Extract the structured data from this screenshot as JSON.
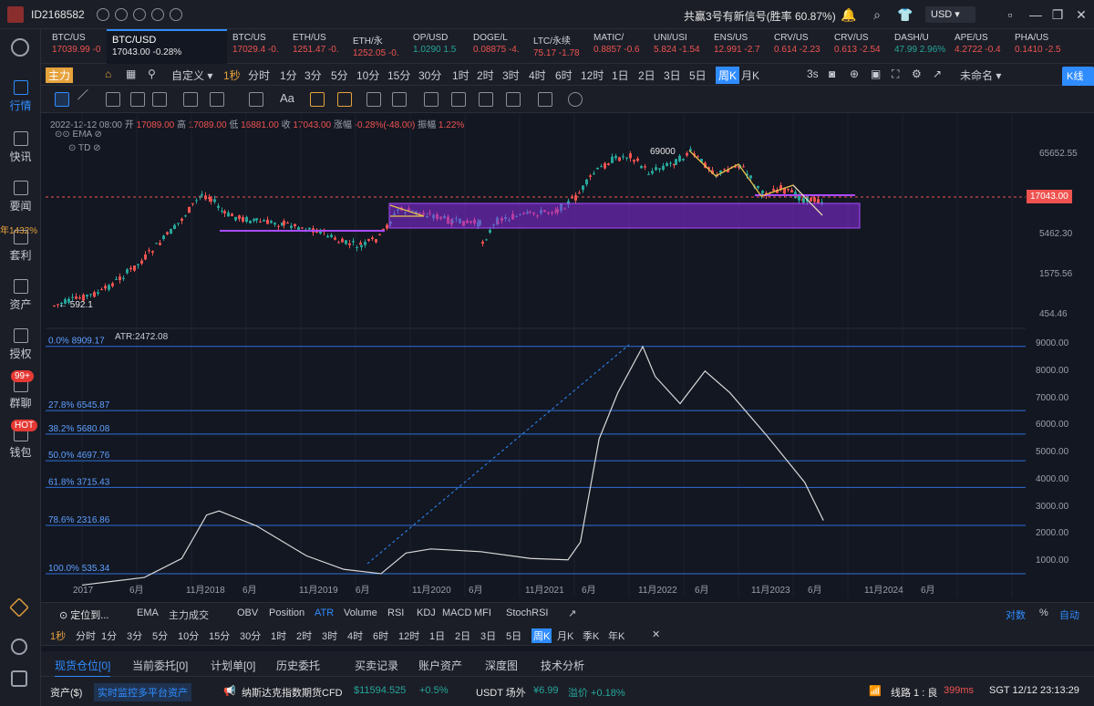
{
  "titlebar": {
    "account": "ID2168582",
    "signal_text": "共赢3号有新信号(胜率 60.87%)",
    "currency": "USD"
  },
  "sidebar": {
    "items": [
      {
        "label": "行情",
        "icon": "market-icon"
      },
      {
        "label": "快讯",
        "icon": "news-icon"
      },
      {
        "label": "要闻",
        "icon": "headlines-icon"
      },
      {
        "label": "套利",
        "icon": "arbitrage-icon",
        "tag": "年1432%"
      },
      {
        "label": "资产",
        "icon": "assets-icon"
      },
      {
        "label": "授权",
        "icon": "authorize-icon"
      },
      {
        "label": "群聊",
        "icon": "group-chat-icon",
        "tag": "99+"
      },
      {
        "label": "钱包",
        "icon": "wallet-icon",
        "tag": "HOT"
      }
    ]
  },
  "tickers": [
    {
      "name": "BTC/US",
      "value": "17039.99 -0"
    },
    {
      "name": "BTC/USD",
      "value": "17043.00 -0.28%",
      "active": true
    },
    {
      "name": "BTC/US",
      "value": "17029.4 -0."
    },
    {
      "name": "ETH/US",
      "value": "1251.47 -0."
    },
    {
      "name": "ETH/永",
      "value": "1252.05 -0."
    },
    {
      "name": "OP/USD",
      "value": "1.0290 1.5"
    },
    {
      "name": "DOGE/L",
      "value": "0.08875 -4."
    },
    {
      "name": "LTC/永续",
      "value": "75.17 -1.78"
    },
    {
      "name": "MATIC/",
      "value": "0.8857 -0.6"
    },
    {
      "name": "UNI/USI",
      "value": "5.824 -1.54"
    },
    {
      "name": "ENS/US",
      "value": "12.991 -2.7"
    },
    {
      "name": "CRV/US",
      "value": "0.614 -2.23"
    },
    {
      "name": "CRV/US",
      "value": "0.613 -2.54"
    },
    {
      "name": "DASH/U",
      "value": "47.99 2.96%"
    },
    {
      "name": "APE/US",
      "value": "4.2722 -0.4"
    },
    {
      "name": "PHA/US",
      "value": "0.1410 -2.5"
    }
  ],
  "toolbar": {
    "main_label": "主力",
    "custom_label": "自定义",
    "timeframes": [
      "1秒",
      "分时",
      "1分",
      "3分",
      "5分",
      "10分",
      "15分",
      "30分",
      "1时",
      "2时",
      "3时",
      "4时",
      "6时",
      "12时",
      "1日",
      "2日",
      "3日",
      "5日",
      "周K",
      "月K"
    ],
    "selected_tf": "周K",
    "interval": "3s",
    "layout_name": "未命名",
    "kline_button": "K线分析"
  },
  "ohlc": {
    "date": "2022-12-12 08:00",
    "open_label": "开",
    "open": "17089.00",
    "high_label": "高",
    "high": "17089.00",
    "low_label": "低",
    "low": "16881.00",
    "close_label": "收",
    "close": "17043.00",
    "change_label": "涨幅",
    "change": "-0.28%(-48.00)",
    "amp_label": "振幅",
    "amp": "1.22%"
  },
  "overlays": {
    "ema": "EMA",
    "td": "TD"
  },
  "chart_data": {
    "type": "line",
    "title": "",
    "price_axis": [
      "65652.55",
      "17043.00",
      "5462.30",
      "1575.56",
      "454.46"
    ],
    "last_price": "17043.00",
    "annotations": {
      "high": "69000",
      "low": "592.1"
    },
    "atr_label": "ATR:2472.08",
    "atr_axis": [
      "9000.00",
      "8000.00",
      "7000.00",
      "6000.00",
      "5000.00",
      "4000.00",
      "3000.00",
      "2000.00",
      "1000.00"
    ],
    "fib_levels": [
      {
        "label": "0.0% 8909.17",
        "value": 8909.17
      },
      {
        "label": "27.8% 6545.87",
        "value": 6545.87
      },
      {
        "label": "38.2% 5680.08",
        "value": 5680.08
      },
      {
        "label": "50.0% 4697.76",
        "value": 4697.76
      },
      {
        "label": "61.8% 3715.43",
        "value": 3715.43
      },
      {
        "label": "78.6% 2316.86",
        "value": 2316.86
      },
      {
        "label": "100.0% 535.34",
        "value": 535.34
      }
    ],
    "x_ticks": [
      "2017",
      "6月",
      "11月2018",
      "6月",
      "11月2019",
      "6月",
      "11月2020",
      "6月",
      "11月2021",
      "6月",
      "11月2022",
      "6月",
      "11月2023",
      "6月",
      "11月2024",
      "6月"
    ],
    "atr_series": [
      {
        "x": 2017.0,
        "y": 120
      },
      {
        "x": 2017.5,
        "y": 400
      },
      {
        "x": 2017.8,
        "y": 1100
      },
      {
        "x": 2018.0,
        "y": 2700
      },
      {
        "x": 2018.1,
        "y": 2850
      },
      {
        "x": 2018.4,
        "y": 2300
      },
      {
        "x": 2018.8,
        "y": 1200
      },
      {
        "x": 2019.1,
        "y": 700
      },
      {
        "x": 2019.4,
        "y": 540
      },
      {
        "x": 2019.6,
        "y": 1300
      },
      {
        "x": 2019.8,
        "y": 1450
      },
      {
        "x": 2020.2,
        "y": 1350
      },
      {
        "x": 2020.6,
        "y": 1100
      },
      {
        "x": 2020.9,
        "y": 1050
      },
      {
        "x": 2021.0,
        "y": 1700
      },
      {
        "x": 2021.15,
        "y": 5500
      },
      {
        "x": 2021.3,
        "y": 7200
      },
      {
        "x": 2021.5,
        "y": 8900
      },
      {
        "x": 2021.6,
        "y": 7800
      },
      {
        "x": 2021.8,
        "y": 6800
      },
      {
        "x": 2022.0,
        "y": 8000
      },
      {
        "x": 2022.2,
        "y": 7200
      },
      {
        "x": 2022.5,
        "y": 5600
      },
      {
        "x": 2022.8,
        "y": 3900
      },
      {
        "x": 2022.95,
        "y": 2500
      }
    ]
  },
  "indicator_bar": {
    "locate": "定位到...",
    "items": [
      "EMA",
      "主力成交",
      "OBV",
      "Position",
      "ATR",
      "Volume",
      "RSI",
      "KDJ",
      "MACD",
      "MFI",
      "StochRSI"
    ],
    "selected": "ATR",
    "right": [
      "对数",
      "%",
      "自动"
    ]
  },
  "tf_bar": {
    "items": [
      "1秒",
      "分时",
      "1分",
      "3分",
      "5分",
      "10分",
      "15分",
      "30分",
      "1时",
      "2时",
      "3时",
      "4时",
      "6时",
      "12时",
      "1日",
      "2日",
      "3日",
      "5日",
      "周K",
      "月K",
      "季K",
      "年K"
    ],
    "selected": "周K"
  },
  "bottom_tabs": {
    "items": [
      "现货仓位[0]",
      "当前委托[0]",
      "计划单[0]",
      "历史委托",
      "买卖记录",
      "账户资产",
      "深度图",
      "技术分析"
    ],
    "selected": "现货仓位[0]"
  },
  "status": {
    "assets": "资产($)",
    "monitor": "实时监控多平台资产",
    "nasdaq_label": "纳斯达克指数期货CFD",
    "nasdaq_price": "$11594.525",
    "nasdaq_change": "+0.5%",
    "usdt_label": "USDT 场外",
    "usdt_price": "¥6.99",
    "premium": "溢价 +0.18%",
    "line": "线路 1 : 良",
    "latency": "399ms",
    "time": "SGT 12/12 23:13:29"
  },
  "colors": {
    "up": "#26a69a",
    "down": "#ef5350",
    "accent": "#2f8cff",
    "fib": "#2f6fd6",
    "box": "#8a2be2"
  }
}
